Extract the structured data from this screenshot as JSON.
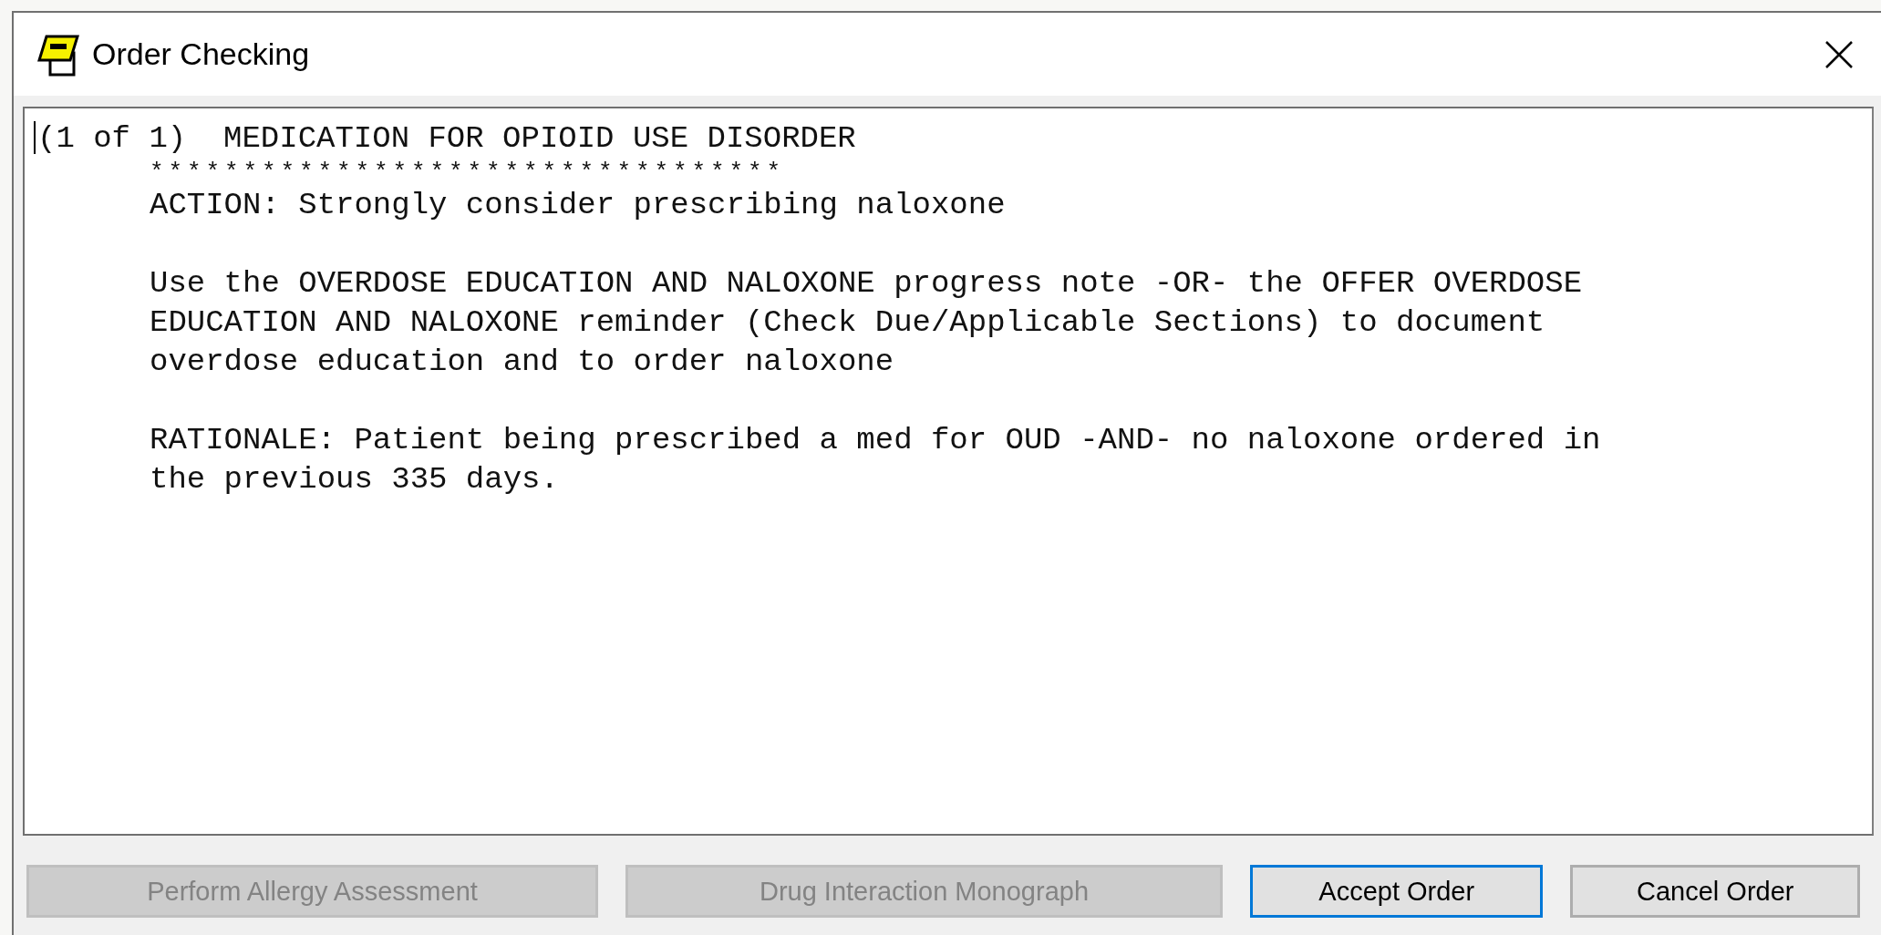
{
  "window": {
    "title": "Order Checking"
  },
  "message": {
    "heading": "(1 of 1)  MEDICATION FOR OPIOID USE DISORDER",
    "separator": "**********************************",
    "paragraphs": [
      {
        "lines": [
          "ACTION: Strongly consider prescribing naloxone"
        ]
      },
      {
        "lines": [
          "Use the OVERDOSE EDUCATION AND NALOXONE progress note -OR- the OFFER OVERDOSE",
          "EDUCATION AND NALOXONE reminder (Check Due/Applicable Sections) to document",
          "overdose education and to order naloxone"
        ]
      },
      {
        "lines": [
          "RATIONALE: Patient being prescribed a med for OUD -AND- no naloxone ordered in",
          "the previous 335 days."
        ]
      }
    ]
  },
  "buttons": [
    {
      "label": "Perform Allergy Assessment",
      "disabled": true,
      "default": false
    },
    {
      "label": "Drug Interaction Monograph",
      "disabled": true,
      "default": false
    },
    {
      "label": "Accept Order",
      "disabled": false,
      "default": true
    },
    {
      "label": "Cancel Order",
      "disabled": false,
      "default": false
    }
  ]
}
